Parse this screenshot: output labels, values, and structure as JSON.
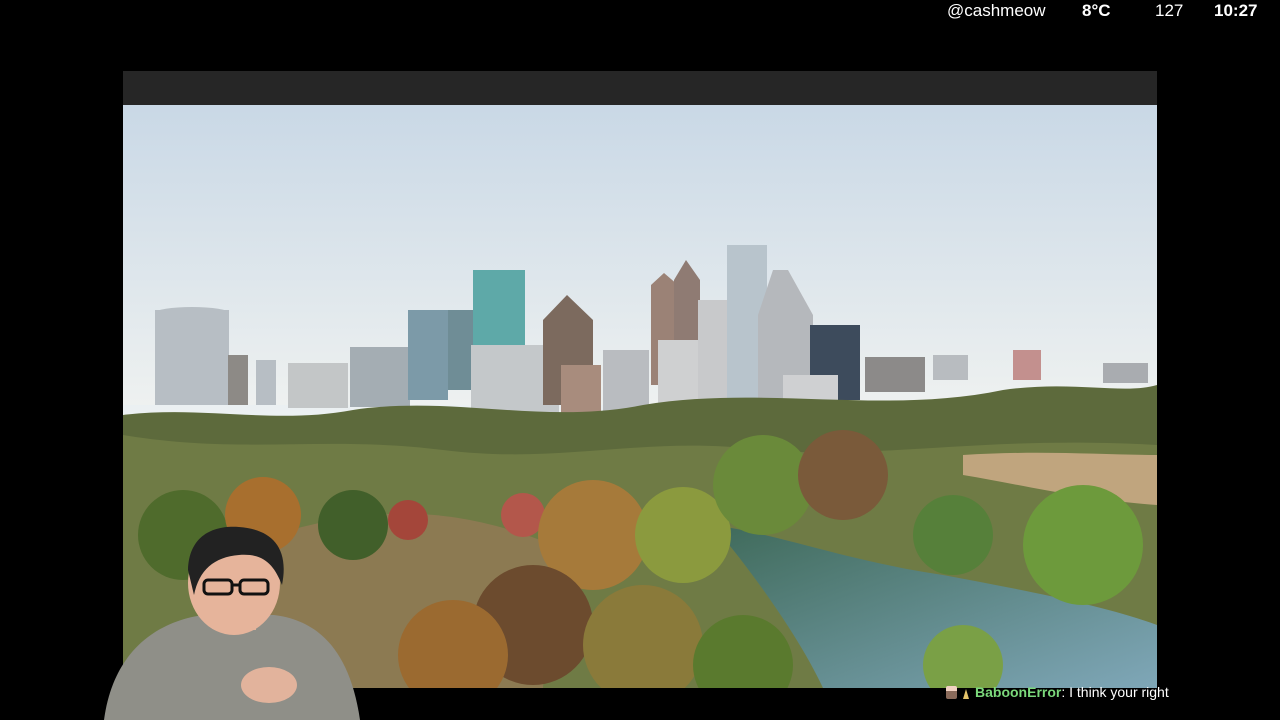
{
  "status": {
    "handle": "@cashmeow",
    "temperature": "8°C",
    "count": "127",
    "clock": "10:27"
  },
  "stream": {
    "video_description_icon": "city-skyline-video",
    "webcam_icon": "streamer-webcam"
  },
  "chat": {
    "username": "BaboonError",
    "separator": ":",
    "message": " I think your right",
    "badges": [
      "subscriber-badge-icon",
      "bits-badge-icon"
    ]
  },
  "colors": {
    "background": "#000000",
    "chat_username": "#7bd87b",
    "player_bar": "#262626"
  }
}
